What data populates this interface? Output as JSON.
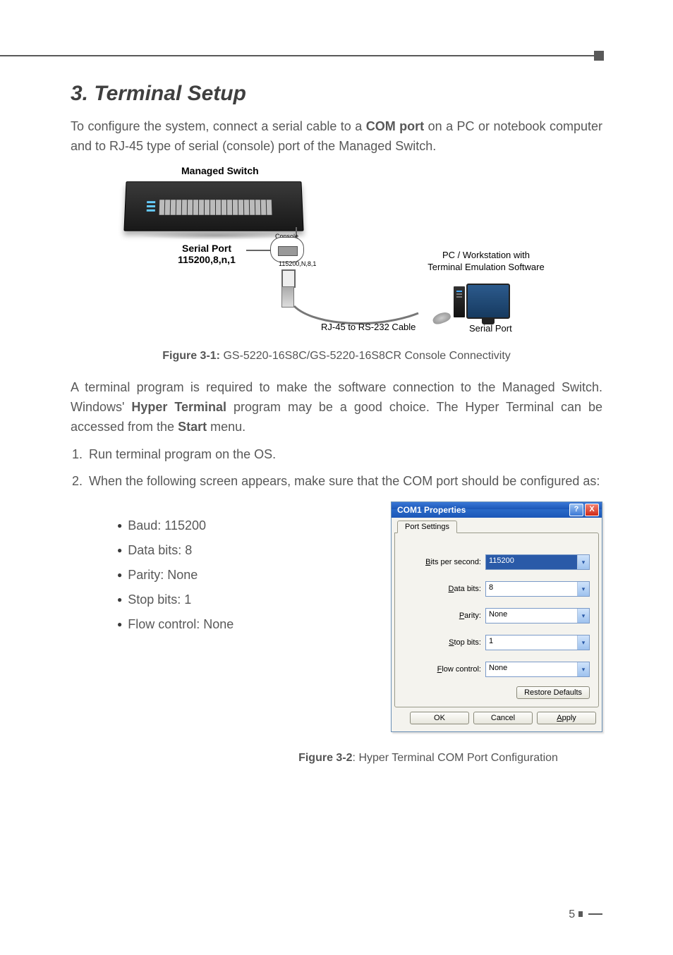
{
  "heading": "3. Terminal Setup",
  "intro": {
    "pre": "To configure the system, connect a serial cable to a ",
    "bold1": "COM port",
    "post": " on a PC or notebook computer and to RJ-45 type of serial (console) port of the Managed Switch."
  },
  "diagram": {
    "managed_switch": "Managed Switch",
    "serial_port_line1": "Serial Port",
    "serial_port_line2": "115200,8,n,1",
    "console": "Console",
    "baud_small": "115200,N,8,1",
    "cable": "RJ-45 to RS-232 Cable",
    "pc_line1": "PC / Workstation with",
    "pc_line2": "Terminal Emulation Software",
    "pc_serial": "Serial Port"
  },
  "fig1": {
    "label": "Figure 3-1:",
    "text": " GS-5220-16S8C/GS-5220-16S8CR Console Connectivity"
  },
  "para2": {
    "pre": "A terminal program is required to make the software connection to the Managed Switch. Windows' ",
    "bold1": "Hyper Terminal",
    "mid": " program may be a good choice. The Hyper Terminal can be accessed from the ",
    "bold2": "Start",
    "post": " menu."
  },
  "steps": {
    "s1": "Run terminal program on the OS.",
    "s2": "When the following screen appears, make sure that the COM port should be configured as:"
  },
  "bullets": {
    "b1": "Baud: 115200",
    "b2": "Data bits: 8",
    "b3": "Parity: None",
    "b4": "Stop bits: 1",
    "b5": "Flow control: None"
  },
  "dialog": {
    "title": "COM1 Properties",
    "tab": "Port Settings",
    "fields": {
      "bits_label_pre": "B",
      "bits_label_post": "its per second:",
      "bits_value": "115200",
      "data_label_pre": "D",
      "data_label_post": "ata bits:",
      "data_value": "8",
      "parity_label_pre": "P",
      "parity_label_post": "arity:",
      "parity_value": "None",
      "stop_label_pre": "S",
      "stop_label_post": "top bits:",
      "stop_value": "1",
      "flow_label_pre": "F",
      "flow_label_post": "low control:",
      "flow_value": "None"
    },
    "restore_pre": "R",
    "restore_post": "estore Defaults",
    "ok": "OK",
    "cancel": "Cancel",
    "apply_pre": "A",
    "apply_post": "pply"
  },
  "fig2": {
    "label": "Figure 3-2",
    "text": ":  Hyper Terminal COM Port Configuration"
  },
  "page_number": "5"
}
